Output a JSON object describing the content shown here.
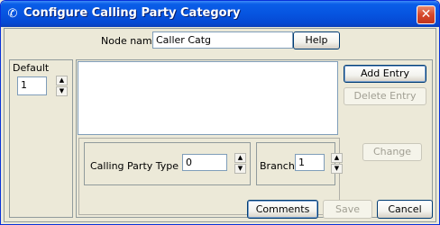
{
  "window": {
    "title": "Configure Calling Party Category",
    "title_icon": "phone-icon",
    "close_glyph": "✕"
  },
  "header": {
    "node_name_label": "Node name",
    "node_name_value": "Caller Catg",
    "help_label": "Help"
  },
  "default_panel": {
    "label": "Default",
    "value": "1"
  },
  "entries": {
    "add_label": "Add Entry",
    "delete_label": "Delete Entry",
    "calling_party_type_label": "Calling Party Type",
    "calling_party_type_value": "0",
    "branch_label": "Branch",
    "branch_value": "1",
    "change_label": "Change"
  },
  "footer": {
    "comments_label": "Comments",
    "save_label": "Save",
    "cancel_label": "Cancel"
  },
  "spinner": {
    "up_glyph": "▲",
    "down_glyph": "▼"
  },
  "colors": {
    "titlebar": "#0654e0",
    "close": "#d6472b",
    "window_bg": "#ece9d8",
    "border": "#919b9c"
  }
}
